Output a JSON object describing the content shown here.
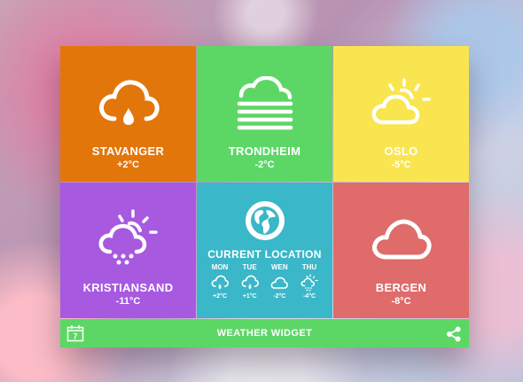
{
  "tiles": [
    {
      "city": "STAVANGER",
      "temp": "+2°C",
      "icon": "cloud-rain-drop-icon",
      "color": "#e2760b"
    },
    {
      "city": "TRONDHEIM",
      "temp": "-2°C",
      "icon": "cloud-fog-icon",
      "color": "#5cd766"
    },
    {
      "city": "OSLO",
      "temp": "-5°C",
      "icon": "sun-behind-cloud-icon",
      "color": "#f9e54f"
    },
    {
      "city": "KRISTIANSAND",
      "temp": "-11°C",
      "icon": "sun-cloud-snow-icon",
      "color": "#a759e0"
    },
    {
      "city": "BERGEN",
      "temp": "-8°C",
      "icon": "cloud-icon",
      "color": "#df6b6b"
    }
  ],
  "current": {
    "label": "CURRENT LOCATION",
    "icon": "globe-icon",
    "color": "#3ab7c8",
    "days": [
      {
        "day": "MON",
        "temp": "+2°C",
        "icon": "cloud-rain-icon"
      },
      {
        "day": "TUE",
        "temp": "+1°C",
        "icon": "cloud-rain-icon"
      },
      {
        "day": "WEN",
        "temp": "-2°C",
        "icon": "cloud-icon"
      },
      {
        "day": "THU",
        "temp": "-4°C",
        "icon": "sun-cloud-snow-icon"
      }
    ]
  },
  "footer": {
    "title": "WEATHER WIDGET",
    "calendar_day": "7",
    "color": "#5cd766"
  }
}
